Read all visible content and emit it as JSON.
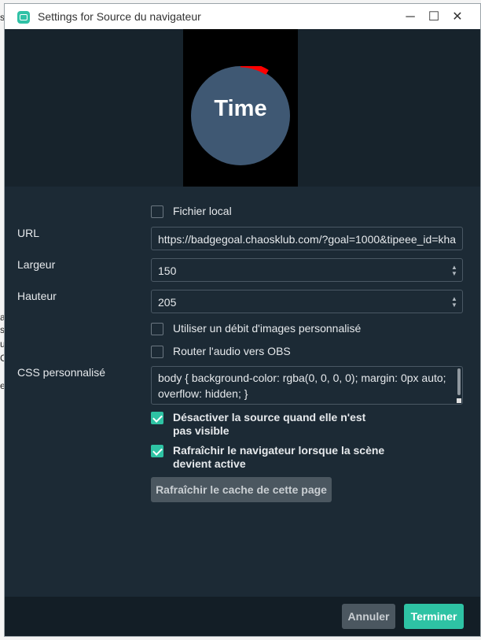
{
  "background_fragments": [
    "s",
    "a",
    "s",
    "u",
    "C",
    "e"
  ],
  "window": {
    "title": "Settings for Source du navigateur",
    "controls": {
      "minimize": "─",
      "maximize": "☐",
      "close": "✕"
    }
  },
  "preview": {
    "badge_text": "Time"
  },
  "form": {
    "local_file_label": "Fichier local",
    "url_label": "URL",
    "url_value": "https://badgegoal.chaosklub.com/?goal=1000&tipeee_id=kha",
    "width_label": "Largeur",
    "width_value": "150",
    "height_label": "Hauteur",
    "height_value": "205",
    "custom_fps_label": "Utiliser un débit d'images personnalisé",
    "route_audio_label": "Router l'audio vers OBS",
    "css_label": "CSS personnalisé",
    "css_value": "body { background-color: rgba(0, 0, 0, 0); margin: 0px auto; overflow: hidden; }",
    "shutdown_label_line1": "Désactiver la source quand elle n'est",
    "shutdown_label_line2": "pas visible",
    "refresh_label_line1": "Rafraîchir le navigateur lorsque la scène",
    "refresh_label_line2": "devient active",
    "refresh_cache_button": "Rafraîchir le cache de cette page"
  },
  "footer": {
    "cancel": "Annuler",
    "done": "Terminer"
  },
  "colors": {
    "accent": "#2ec3a4",
    "background": "#1c2a35",
    "badge": "#3f5873",
    "arc": "#ff0000"
  }
}
